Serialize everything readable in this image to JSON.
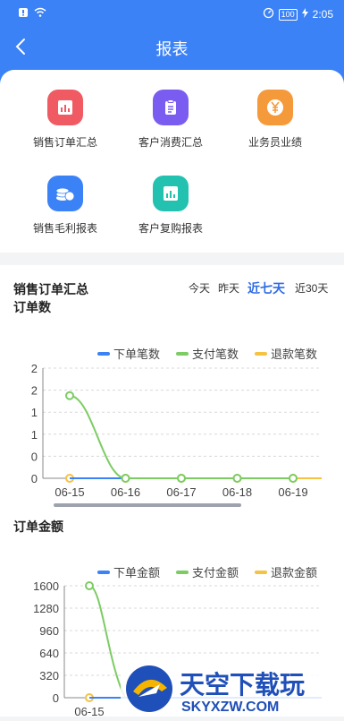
{
  "status": {
    "time": "2:05",
    "battery": "100"
  },
  "header": {
    "title": "报表"
  },
  "menu": [
    {
      "label": "销售订单汇总",
      "color": "#ef5a63",
      "icon": "chart-icon"
    },
    {
      "label": "客户消费汇总",
      "color": "#7b5cf0",
      "icon": "clipboard-icon"
    },
    {
      "label": "业务员业绩",
      "color": "#f59a3b",
      "icon": "yen-icon"
    },
    {
      "label": "销售毛利报表",
      "color": "#3b82f6",
      "icon": "coins-icon"
    },
    {
      "label": "客户复购报表",
      "color": "#22c1b0",
      "icon": "chart-icon"
    }
  ],
  "summary": {
    "title": "销售订单汇总",
    "date_tabs": [
      "今天",
      "昨天",
      "近七天",
      "近30天"
    ],
    "active_tab": "近七天"
  },
  "chart1": {
    "title": "订单数",
    "legend": [
      "下单笔数",
      "支付笔数",
      "退款笔数"
    ]
  },
  "chart2": {
    "title": "订单金额",
    "legend": [
      "下单金额",
      "支付金额",
      "退款金额"
    ]
  },
  "watermark": {
    "text": "天空下载玩",
    "subtext": "SKYXZW.COM"
  },
  "chart_data": [
    {
      "type": "line",
      "title": "订单数",
      "x": [
        "06-15",
        "06-16",
        "06-17",
        "06-18",
        "06-19"
      ],
      "yticks": [
        "2",
        "2",
        "1",
        "1",
        "0",
        "0"
      ],
      "ylim": [
        0,
        2
      ],
      "series": [
        {
          "name": "下单笔数",
          "color": "#3b82f6",
          "values": [
            0,
            0,
            0,
            0,
            0
          ]
        },
        {
          "name": "支付笔数",
          "color": "#7ccc63",
          "values": [
            1.5,
            0,
            0,
            0,
            0
          ]
        },
        {
          "name": "退款笔数",
          "color": "#f5c242",
          "values": [
            0,
            0,
            0,
            0,
            0
          ]
        }
      ],
      "legend_position": "top-right",
      "grid": true
    },
    {
      "type": "line",
      "title": "订单金额",
      "x": [
        "06-15"
      ],
      "yticks": [
        "1600",
        "1280",
        "960",
        "640",
        "320",
        "0"
      ],
      "ylim": [
        0,
        1600
      ],
      "series": [
        {
          "name": "下单金额",
          "color": "#3b82f6",
          "values": [
            0
          ]
        },
        {
          "name": "支付金额",
          "color": "#7ccc63",
          "values": [
            1600
          ]
        },
        {
          "name": "退款金额",
          "color": "#f5c242",
          "values": [
            0
          ]
        }
      ],
      "legend_position": "top-right",
      "grid": true
    }
  ]
}
